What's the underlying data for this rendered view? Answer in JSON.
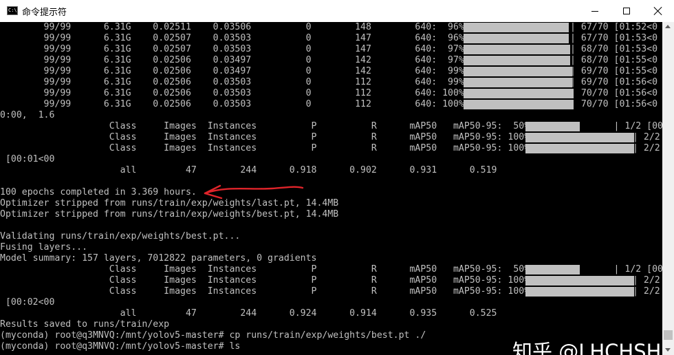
{
  "window": {
    "title": "命令提示符",
    "app_icon_text": "C:\\"
  },
  "console": {
    "lines": [
      "        99/99      6.31G    0.02511    0.03506          0        148        640:  96%|",
      "        99/99      6.31G    0.02507    0.03503          0        147        640:  96%|",
      "        99/99      6.31G    0.02507    0.03503          0        147        640:  97%|",
      "        99/99      6.31G    0.02506    0.03497          0        142        640:  97%|",
      "        99/99      6.31G    0.02506    0.03497          0        142        640:  99%|",
      "        99/99      6.31G    0.02506    0.03503          0        112        640:  99%|",
      "        99/99      6.31G    0.02506    0.03503          0        112        640: 100%|",
      "        99/99      6.31G    0.02506    0.03503          0        112        640: 100%|",
      "0:00,  1.6",
      "                    Class     Images  Instances          P          R      mAP50   mAP50-95:  50%|",
      "                    Class     Images  Instances          P          R      mAP50   mAP50-95: 100%|",
      "                    Class     Images  Instances          P          R      mAP50   mAP50-95: 100%|",
      " [00:01<00",
      "                      all         47        244      0.918      0.902      0.931      0.519",
      "",
      "100 epochs completed in 3.369 hours.",
      "Optimizer stripped from runs/train/exp/weights/last.pt, 14.4MB",
      "Optimizer stripped from runs/train/exp/weights/best.pt, 14.4MB",
      "",
      "Validating runs/train/exp/weights/best.pt...",
      "Fusing layers...",
      "Model summary: 157 layers, 7012822 parameters, 0 gradients",
      "                    Class     Images  Instances          P          R      mAP50   mAP50-95:  50%|",
      "                    Class     Images  Instances          P          R      mAP50   mAP50-95: 100%|",
      "                    Class     Images  Instances          P          R      mAP50   mAP50-95: 100%|",
      " [00:02<00",
      "                      all         47        244      0.924      0.914      0.935      0.525",
      "Results saved to runs/train/exp",
      "(myconda) root@q3MNVQ:/mnt/yolov5-master# cp runs/train/exp/weights/best.pt ./",
      "(myconda) root@q3MNVQ:/mnt/yolov5-master# ls"
    ],
    "progress_tail": [
      "| 67/70 [01:52<0",
      "| 67/70 [01:53<0",
      "| 68/70 [01:53<0",
      "| 68/70 [01:55<0",
      "| 69/70 [01:55<0",
      "| 69/70 [01:56<0",
      "| 70/70 [01:56<0",
      "| 70/70 [01:56<0",
      "",
      "        | 1/2 [00:",
      "| 2/2",
      "| 2/2",
      "",
      "",
      "",
      "",
      "",
      "",
      "",
      "",
      "",
      "",
      "        | 1/2 [00:",
      "| 2/2",
      "| 2/2"
    ],
    "epoch_progress": [
      0.957,
      0.957,
      0.971,
      0.971,
      0.986,
      0.986,
      1.0,
      1.0
    ],
    "val_progress_1": [
      0.5,
      1.0,
      1.0
    ],
    "val_progress_2": [
      0.5,
      1.0,
      1.0
    ]
  },
  "watermark": "知乎 @LHCHSH",
  "colors": {
    "console_bg": "#000000",
    "console_text": "#c0c0c0",
    "arrow": "#e0242a",
    "titlebar_bg": "#ffffff"
  }
}
